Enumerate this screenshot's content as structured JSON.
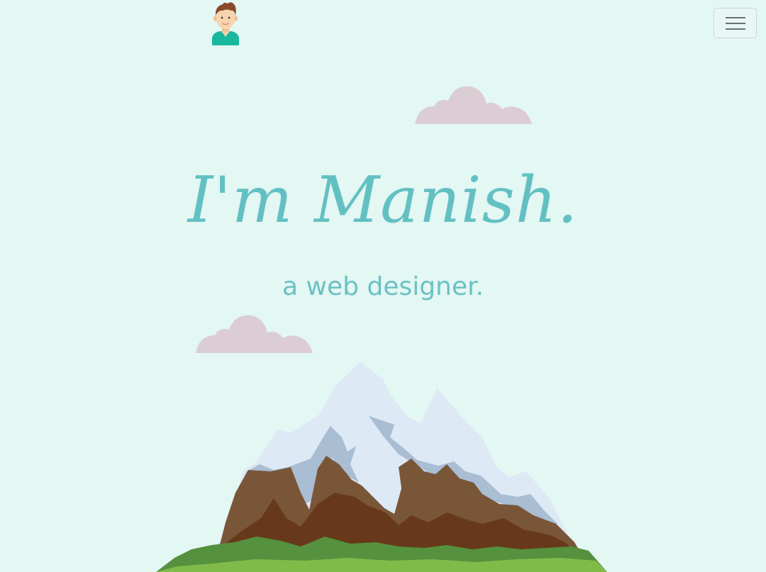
{
  "header": {
    "avatar_icon": "man-avatar-icon",
    "menu_icon": "hamburger-menu-icon"
  },
  "hero": {
    "title": "I'm Manish.",
    "subtitle": "a web designer."
  },
  "colors": {
    "background": "#e3f7f3",
    "accent": "#63c0c2",
    "cloud": "#dbcdd3"
  },
  "illustration": {
    "clouds": [
      "cloud-icon",
      "cloud-icon"
    ],
    "mountain": "mountain-illustration"
  }
}
